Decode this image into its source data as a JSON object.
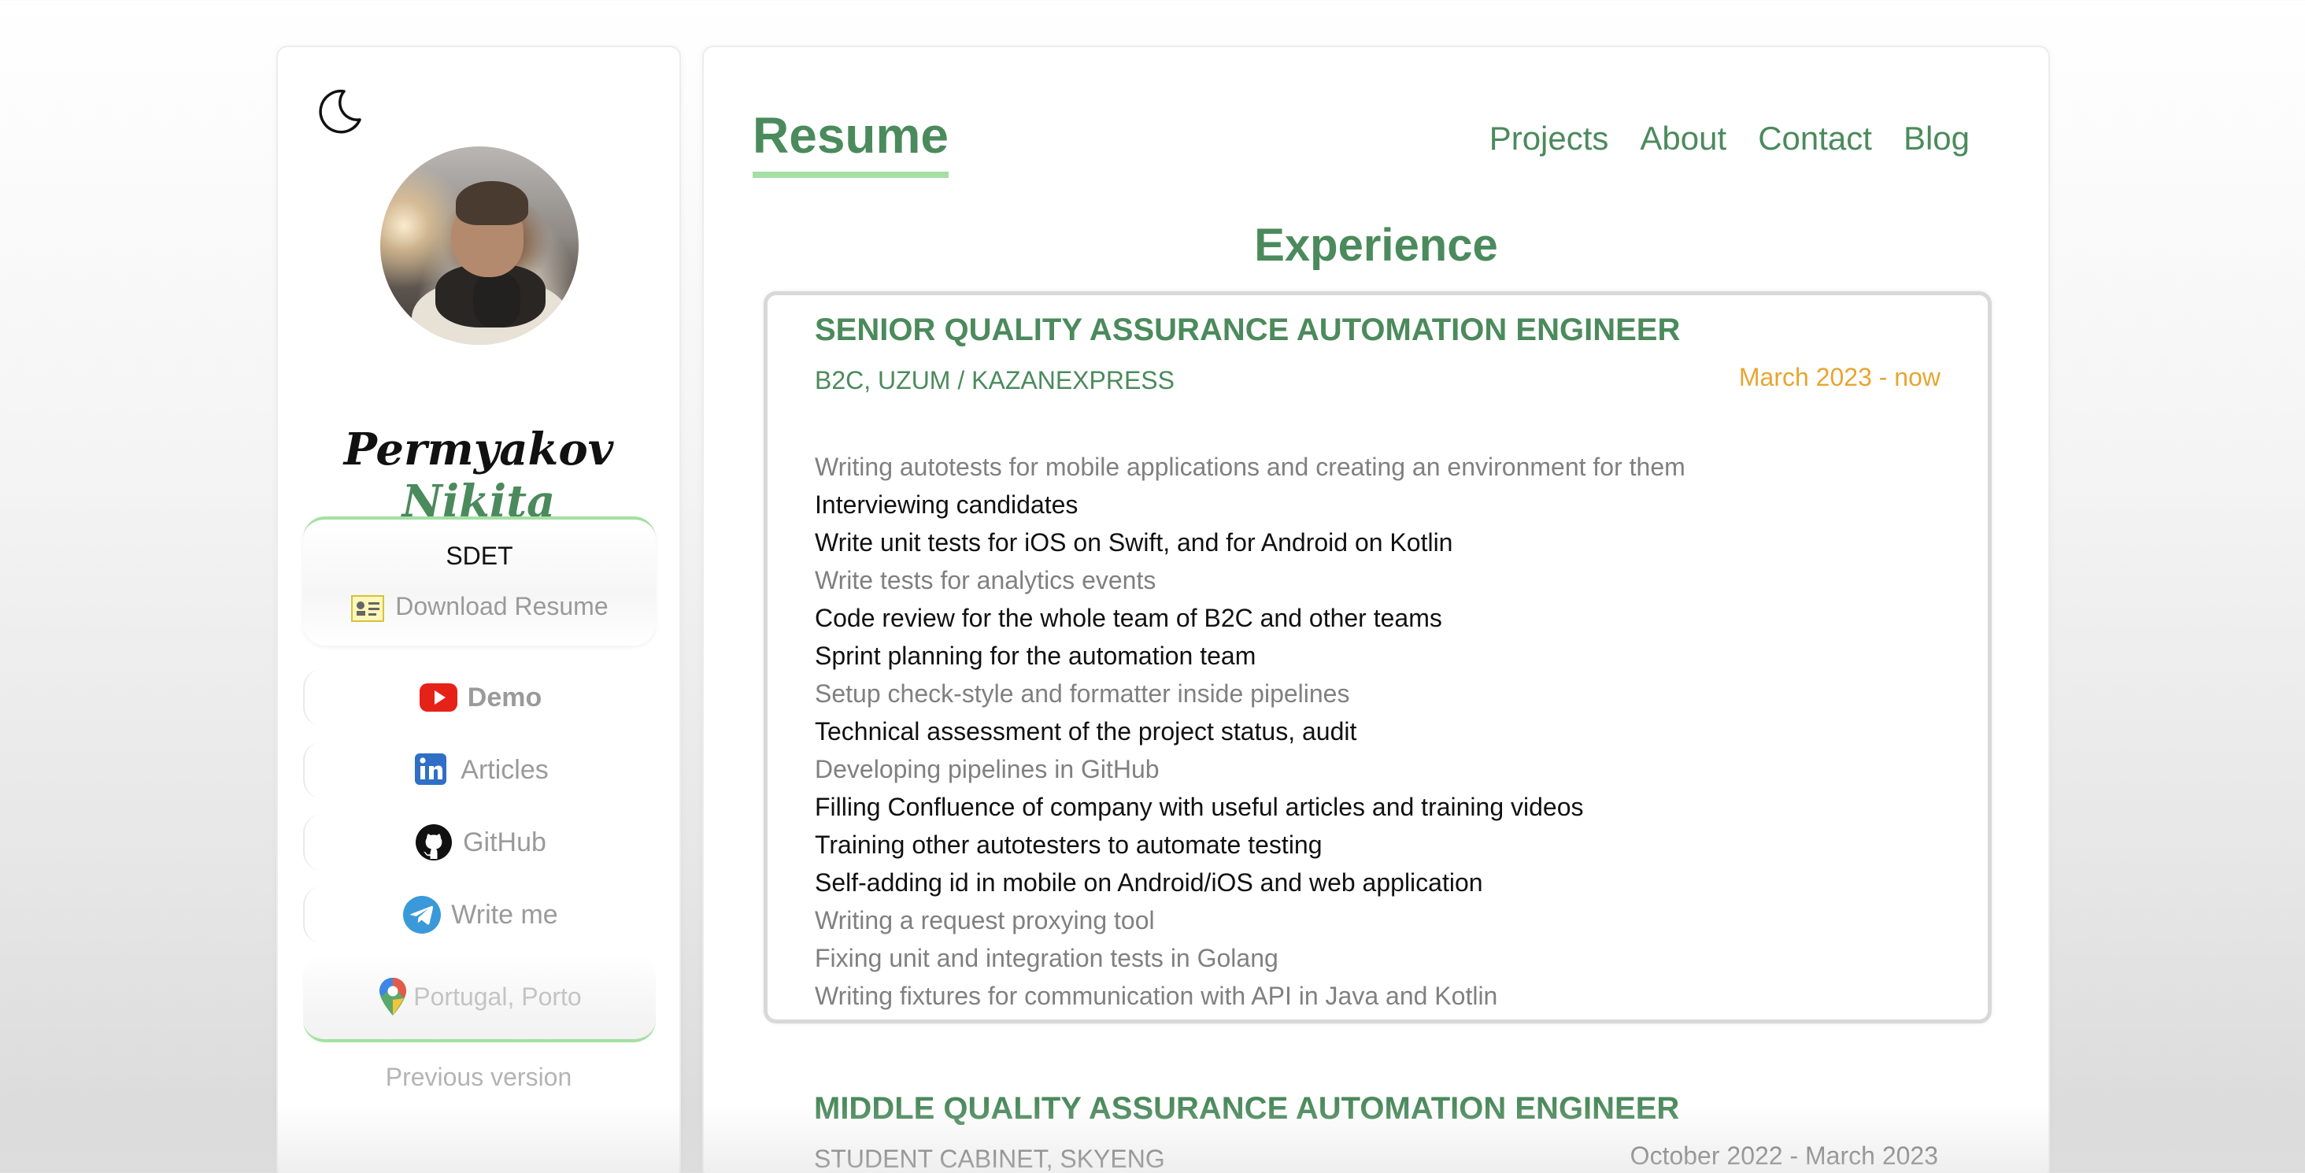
{
  "sidebar": {
    "theme_toggle_icon": "moon-icon",
    "avatar_icon": "profile-photo",
    "name_first": "Permyakov",
    "name_last": "Nikita",
    "role": "SDET",
    "download_label": "Download Resume",
    "links": [
      {
        "label": "Demo",
        "icon": "youtube-icon",
        "color": "#e62117"
      },
      {
        "label": "Articles",
        "icon": "linkedin-icon",
        "color": "#2f6fc6"
      },
      {
        "label": "GitHub",
        "icon": "github-icon",
        "color": "#111111"
      },
      {
        "label": "Write me",
        "icon": "telegram-icon",
        "color": "#3a9ad9"
      }
    ],
    "location": "Portugal, Porto",
    "previous_version": "Previous version"
  },
  "header": {
    "brand": "Resume",
    "nav": [
      "Projects",
      "About",
      "Contact",
      "Blog"
    ]
  },
  "main": {
    "section_title": "Experience",
    "jobs": [
      {
        "title": "SENIOR QUALITY ASSURANCE AUTOMATION ENGINEER",
        "company": "B2C, UZUM / KAZANEXPRESS",
        "period": "March 2023 - now",
        "duties": [
          "Writing autotests for mobile applications and creating an environment for them",
          "Interviewing candidates",
          "Write unit tests for iOS on Swift, and for Android on Kotlin",
          "Write tests for analytics events",
          "Code review for the whole team of B2C and other teams",
          "Sprint planning for the automation team",
          "Setup check-style and formatter inside pipelines",
          "Technical assessment of the project status, audit",
          "Developing pipelines in GitHub",
          "Filling Confluence of company with useful articles and training videos",
          "Training other autotesters to automate testing",
          "Self-adding id in mobile on Android/iOS and web application",
          "Writing a request proxying tool",
          "Fixing unit and integration tests in Golang",
          "Writing fixtures for communication with API in Java and Kotlin"
        ]
      },
      {
        "title": "MIDDLE QUALITY ASSURANCE AUTOMATION ENGINEER",
        "company": "STUDENT CABINET, SKYENG",
        "period": "October 2022 - March 2023"
      }
    ]
  },
  "colors": {
    "accent": "#4b8a5c",
    "underline": "#a4e0a4",
    "period": "#e8a530"
  }
}
